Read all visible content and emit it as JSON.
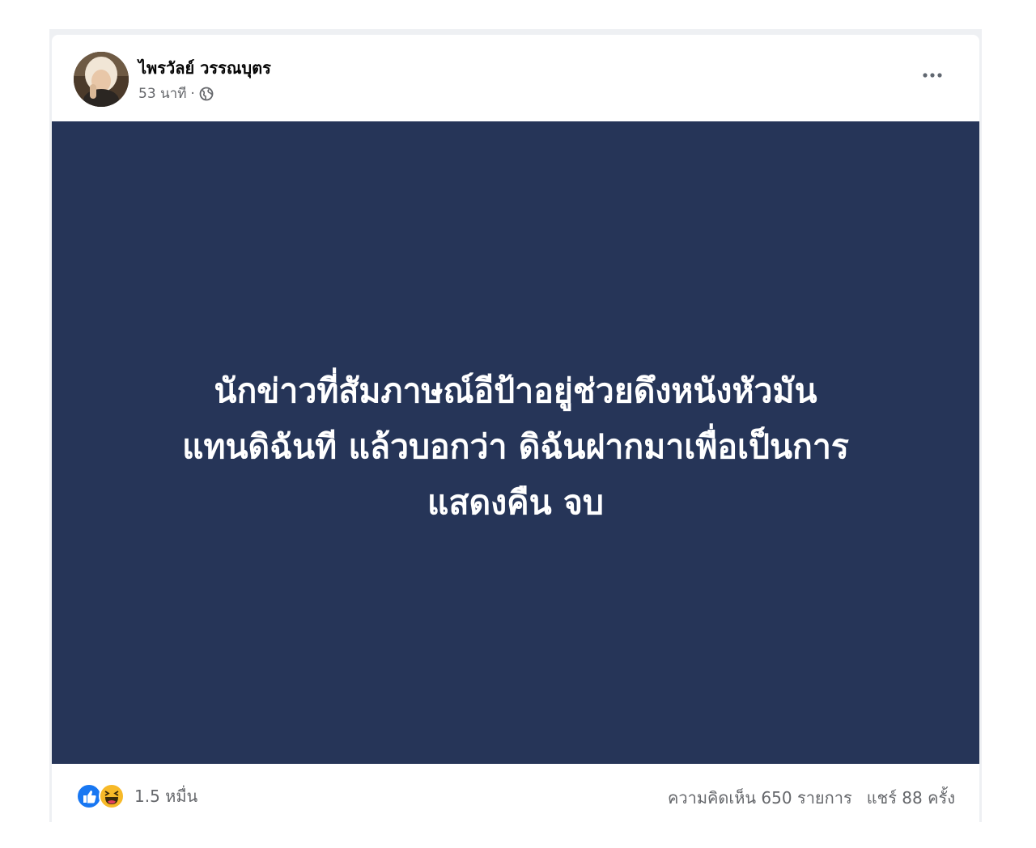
{
  "post": {
    "author_name": "ไพรวัลย์ วรรณบุตร",
    "time": "53 นาที",
    "separator": "·",
    "privacy_icon": "globe-icon",
    "more_icon": "more-horizontal-icon",
    "image_text_lines": [
      "นักข่าวที่สัมภาษณ์อีป้าอยู่ช่วยดึงหนังหัวมัน",
      "แทนดิฉันที แล้วบอกว่า ดิฉันฝากมาเพื่อเป็นการ",
      "แสดงคืน จบ"
    ],
    "image_background": "#263558"
  },
  "footer": {
    "reaction_icons": [
      "like-icon",
      "haha-icon"
    ],
    "reaction_count": "1.5 หมื่น",
    "comments": "ความคิดเห็น 650 รายการ",
    "shares": "แชร์ 88 ครั้ง"
  },
  "colors": {
    "like_blue": "#1877f2",
    "haha_yellow": "#f7b928",
    "secondary_text": "#65676b",
    "primary_text": "#050505"
  }
}
